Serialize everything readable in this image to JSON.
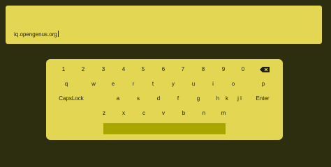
{
  "text_field": {
    "value": "iq.opengenus.org"
  },
  "keyboard": {
    "row1": [
      "1",
      "2",
      "3",
      "4",
      "5",
      "6",
      "7",
      "8",
      "9",
      "0"
    ],
    "row2": [
      "q",
      "w",
      "e",
      "r",
      "t",
      "y",
      "u",
      "i",
      "o",
      "p"
    ],
    "row3": [
      "CapsLock",
      "a",
      "s",
      "d",
      "f",
      "g",
      "h",
      "j",
      "k",
      "l",
      "Enter"
    ],
    "row4": [
      "z",
      "x",
      "c",
      "v",
      "b",
      "n",
      "m"
    ],
    "backspace_icon": "backspace-icon",
    "space_label": ""
  },
  "colors": {
    "background": "#2d2e0f",
    "panel": "#e2d652",
    "spacebar": "#aaa600",
    "text": "#1e1e10"
  }
}
